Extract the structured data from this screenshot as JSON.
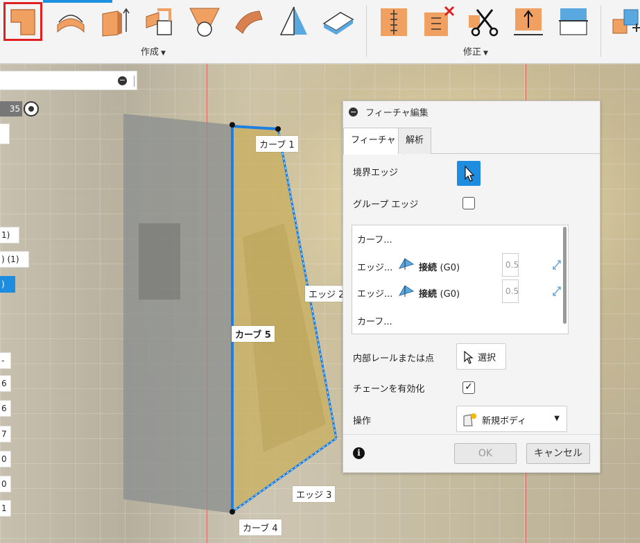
{
  "toolbar": {
    "groups": [
      {
        "label": "作成",
        "caret": "▼"
      },
      {
        "label": "修正",
        "caret": "▼"
      }
    ]
  },
  "browser": {
    "value_chip": "35",
    "items": [
      {
        "text": "1)"
      },
      {
        "text": ") (1)"
      },
      {
        "text": ")",
        "selected": true
      },
      {
        "text": "-"
      },
      {
        "text": "6"
      },
      {
        "text": "6"
      },
      {
        "text": "7"
      },
      {
        "text": "0"
      },
      {
        "text": "0"
      },
      {
        "text": "1"
      }
    ]
  },
  "model": {
    "labels": {
      "curve1": "カーブ 1",
      "edge2": "エッジ 2",
      "curve5": "カーブ 5",
      "edge3": "エッジ 3",
      "curve4": "カーブ 4"
    },
    "colors": {
      "selection_blue": "#1e7fe0",
      "body_gold": "#c8ad5a"
    }
  },
  "dialog": {
    "title": "フィーチャ編集",
    "tabs": [
      "フィーチャ",
      "解析"
    ],
    "boundary_edges_label": "境界エッジ",
    "group_edges_label": "グループ エッジ",
    "group_edges_checked": false,
    "list": {
      "rows": [
        {
          "name": "カーフ..."
        },
        {
          "name": "エッジ...",
          "continuity": "接続",
          "code": "(G0)",
          "weight": "0.5"
        },
        {
          "name": "エッジ...",
          "continuity": "接続",
          "code": "(G0)",
          "weight": "0.5"
        },
        {
          "name": "カーフ..."
        }
      ]
    },
    "rails_label": "内部レールまたは点",
    "select_label": "選択",
    "chain_label": "チェーンを有効化",
    "chain_checked": true,
    "chain_check_glyph": "✓",
    "operation_label": "操作",
    "operation_value": "新規ボディ",
    "info_glyph": "i",
    "ok_label": "OK",
    "cancel_label": "キャンセル"
  }
}
